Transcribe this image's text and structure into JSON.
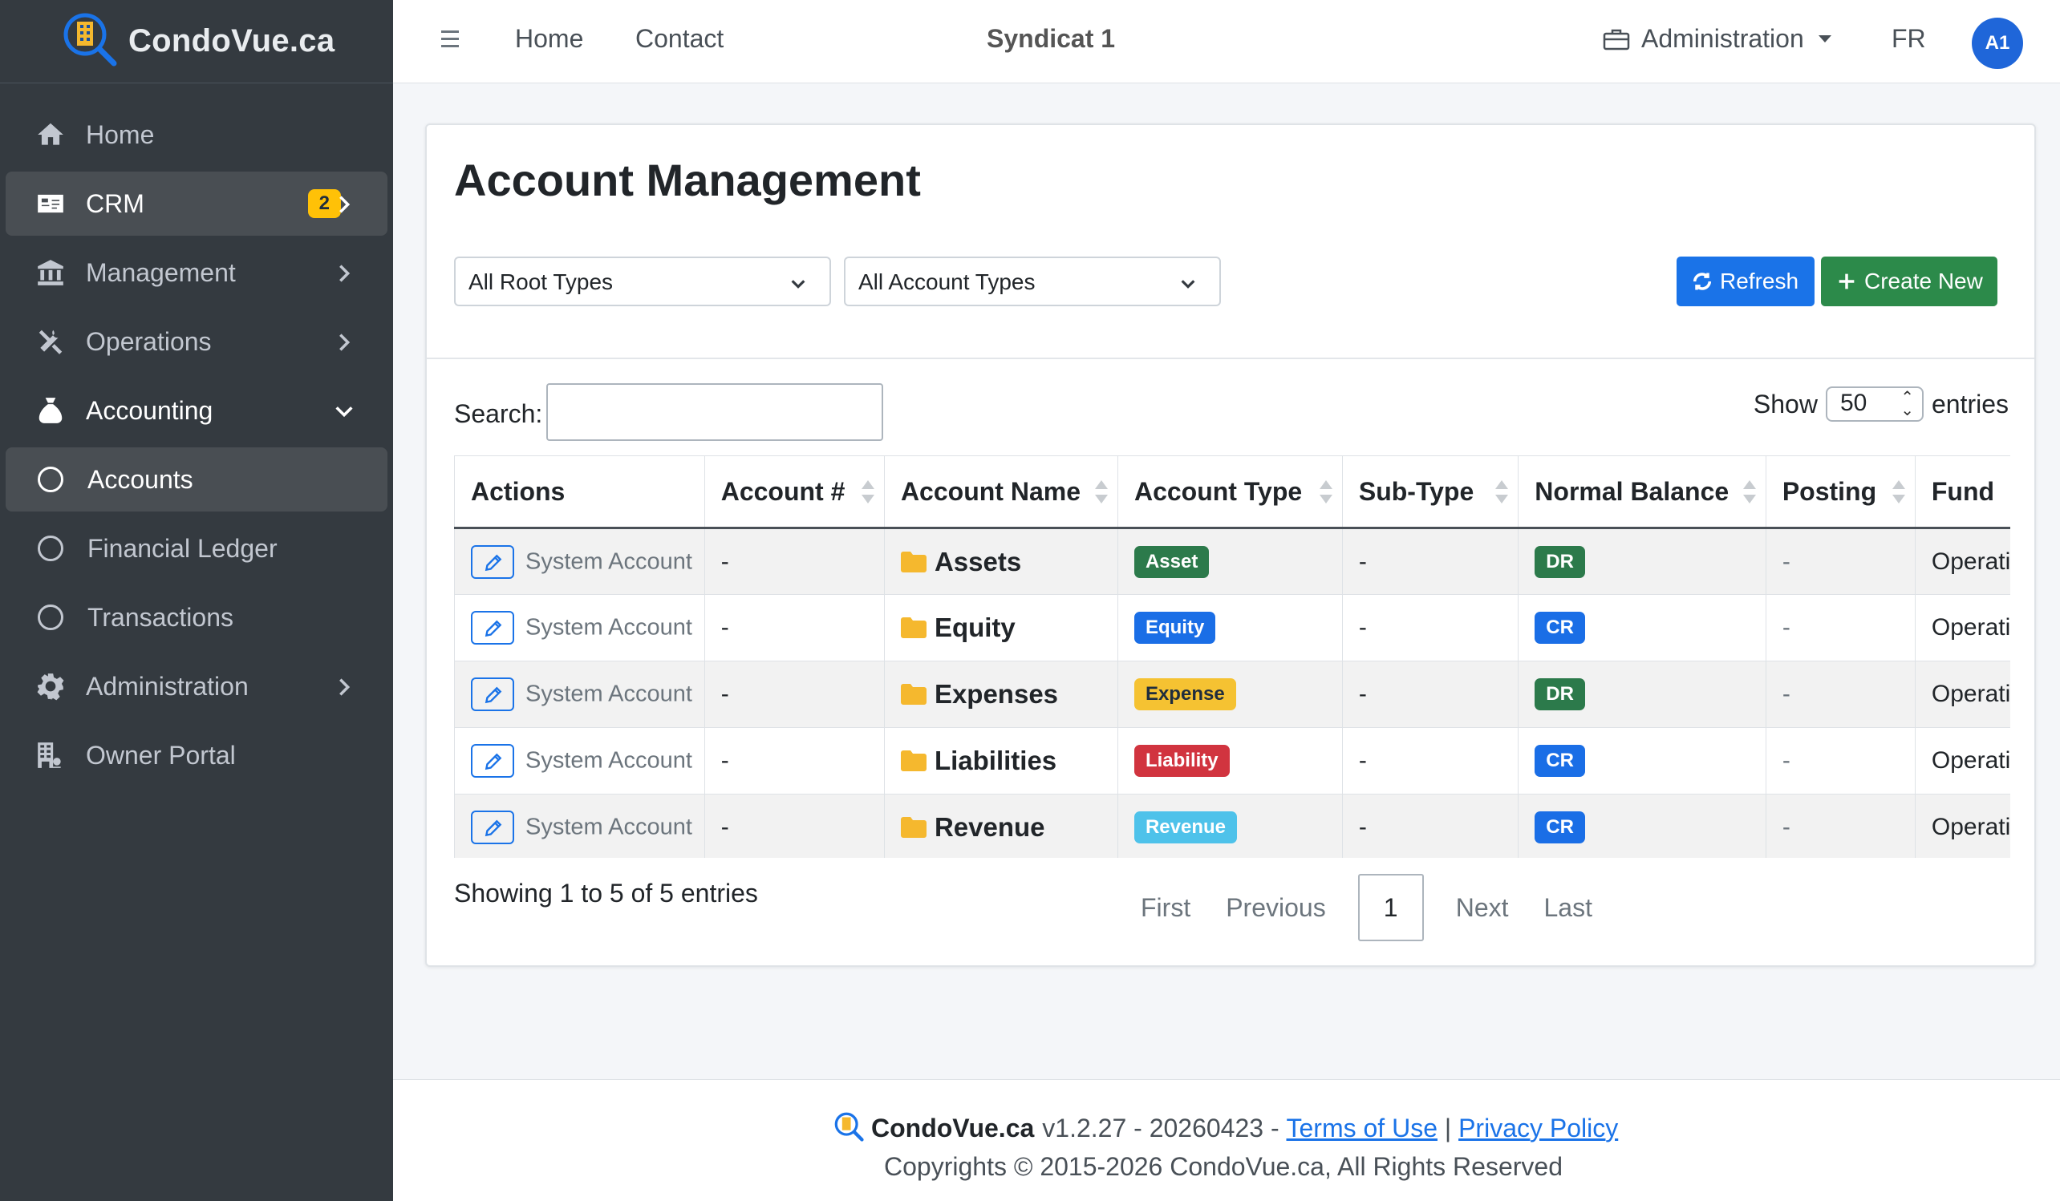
{
  "brand": {
    "name": "CondoVue.ca"
  },
  "sidebar": {
    "items": [
      {
        "label": "Home"
      },
      {
        "label": "CRM",
        "badge": "2"
      },
      {
        "label": "Management"
      },
      {
        "label": "Operations"
      },
      {
        "label": "Accounting"
      },
      {
        "label": "Accounts"
      },
      {
        "label": "Financial Ledger"
      },
      {
        "label": "Transactions"
      },
      {
        "label": "Administration"
      },
      {
        "label": "Owner Portal"
      }
    ]
  },
  "topbar": {
    "home": "Home",
    "contact": "Contact",
    "title": "Syndicat 1",
    "admin": "Administration",
    "lang": "FR",
    "avatar": "A1"
  },
  "page": {
    "title": "Account Management",
    "root_filter": "All Root Types",
    "type_filter": "All Account Types",
    "refresh": "Refresh",
    "create": "Create New",
    "search_label": "Search:",
    "show_label": "Show",
    "show_value": "50",
    "entries_label": "entries"
  },
  "table": {
    "headers": [
      "Actions",
      "Account #",
      "Account Name",
      "Account Type",
      "Sub-Type",
      "Normal Balance",
      "Posting",
      "Fund"
    ],
    "rows": [
      {
        "action": "System Account",
        "number": "-",
        "name": "Assets",
        "type": "Asset",
        "subtype": "-",
        "balance": "DR",
        "posting": "-",
        "fund": "Operating"
      },
      {
        "action": "System Account",
        "number": "-",
        "name": "Equity",
        "type": "Equity",
        "subtype": "-",
        "balance": "CR",
        "posting": "-",
        "fund": "Operating"
      },
      {
        "action": "System Account",
        "number": "-",
        "name": "Expenses",
        "type": "Expense",
        "subtype": "-",
        "balance": "DR",
        "posting": "-",
        "fund": "Operating"
      },
      {
        "action": "System Account",
        "number": "-",
        "name": "Liabilities",
        "type": "Liability",
        "subtype": "-",
        "balance": "CR",
        "posting": "-",
        "fund": "Operating"
      },
      {
        "action": "System Account",
        "number": "-",
        "name": "Revenue",
        "type": "Revenue",
        "subtype": "-",
        "balance": "CR",
        "posting": "-",
        "fund": "Operating"
      }
    ]
  },
  "pagination": {
    "info": "Showing 1 to 5 of 5 entries",
    "first": "First",
    "previous": "Previous",
    "current": "1",
    "next": "Next",
    "last": "Last"
  },
  "footer": {
    "brand": "CondoVue.ca",
    "version": "v1.2.27 - 20260423 -",
    "terms": "Terms of Use",
    "sep": "|",
    "privacy": "Privacy Policy",
    "copyright": "Copyrights © 2015-2026 CondoVue.ca, All Rights Reserved"
  },
  "colors": {
    "sidebar": "#343a40",
    "primary": "#1a73e8",
    "success": "#2c8a4a",
    "warning": "#ffc107",
    "danger": "#d1343f",
    "info": "#4ec2ea"
  }
}
